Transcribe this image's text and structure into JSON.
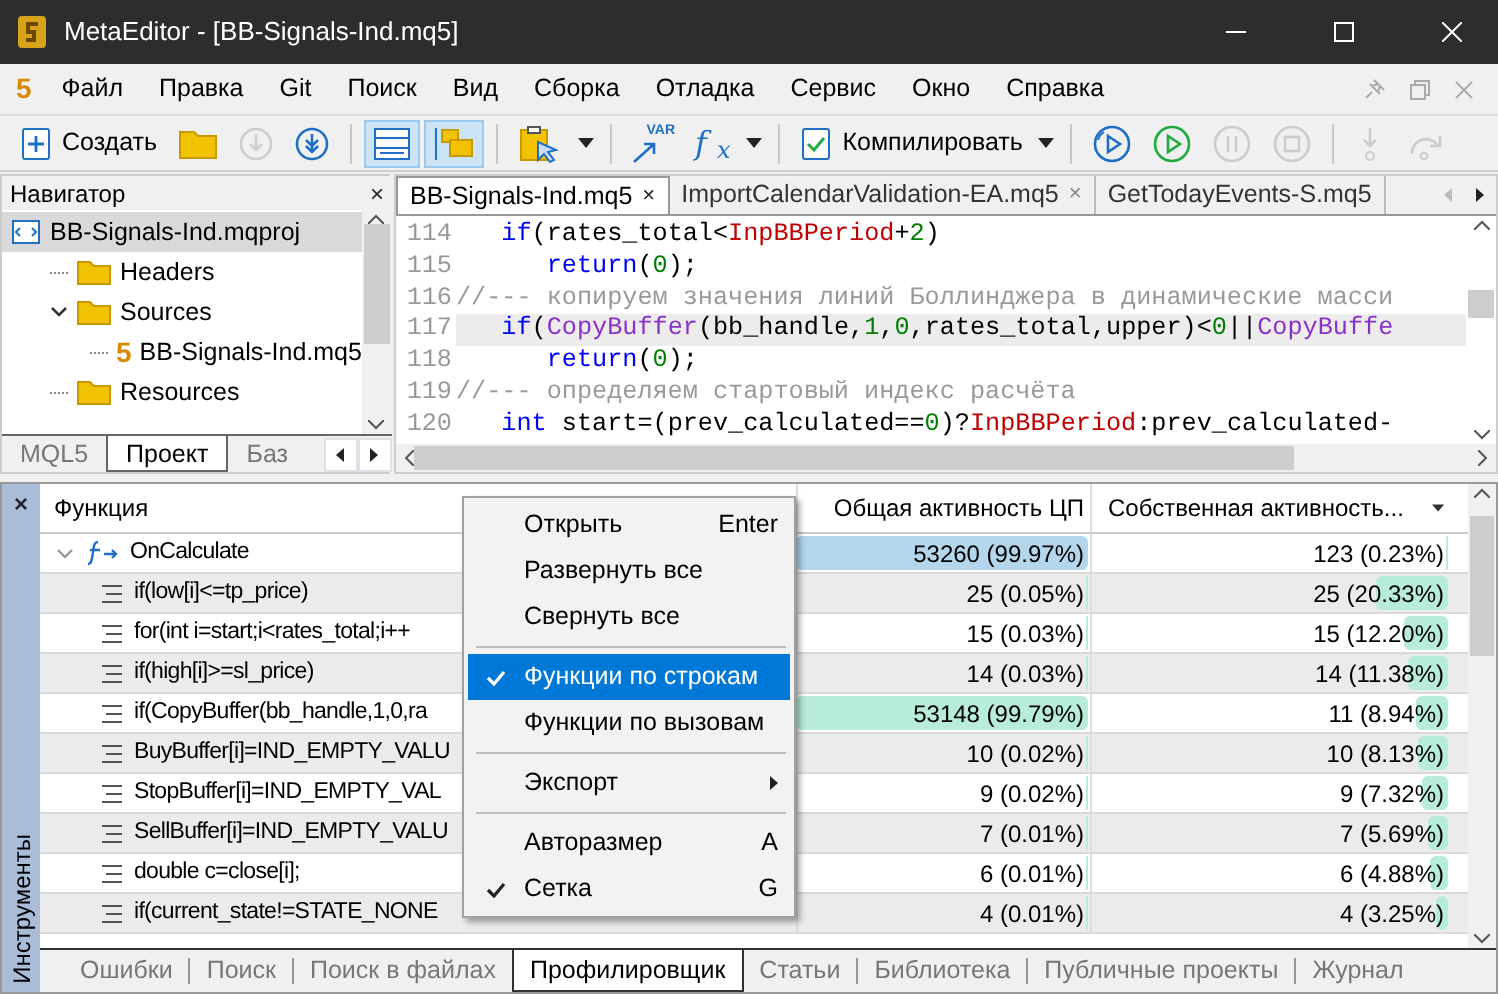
{
  "window": {
    "title": "MetaEditor - [BB-Signals-Ind.mq5]",
    "logo": "5"
  },
  "menu": [
    "Файл",
    "Правка",
    "Git",
    "Поиск",
    "Вид",
    "Сборка",
    "Отладка",
    "Сервис",
    "Окно",
    "Справка"
  ],
  "toolbar": [
    {
      "kind": "labeled",
      "label": "Создать",
      "disabled": false,
      "on": false
    },
    {
      "kind": "icon",
      "disabled": false,
      "on": false
    },
    {
      "kind": "icon",
      "disabled": true,
      "on": false
    },
    {
      "kind": "icon",
      "disabled": false,
      "on": false
    },
    {
      "kind": "separator"
    },
    {
      "kind": "icon",
      "disabled": false,
      "on": true
    },
    {
      "kind": "icon",
      "disabled": false,
      "on": true
    },
    {
      "kind": "separator"
    },
    {
      "kind": "icon",
      "disabled": false,
      "on": false
    },
    {
      "kind": "caret"
    },
    {
      "kind": "separator"
    },
    {
      "kind": "badge",
      "label": "VAR",
      "disabled": false,
      "on": false
    },
    {
      "kind": "glyph",
      "label": "f$_{x}$",
      "disabled": false,
      "on": false
    },
    {
      "kind": "caret"
    },
    {
      "kind": "separator"
    },
    {
      "kind": "labeled",
      "label": "Компилировать",
      "disabled": false,
      "on": false
    },
    {
      "kind": "caret"
    },
    {
      "kind": "separator"
    },
    {
      "kind": "icon",
      "disabled": false,
      "on": false
    },
    {
      "kind": "icon",
      "disabled": false,
      "on": false
    },
    {
      "kind": "icon",
      "disabled": true,
      "on": false
    },
    {
      "kind": "icon",
      "disabled": true,
      "on": false
    },
    {
      "kind": "separator"
    },
    {
      "kind": "icon",
      "disabled": true,
      "on": false
    },
    {
      "kind": "icon",
      "disabled": true,
      "on": false
    }
  ],
  "navigator": {
    "title": "Навигатор",
    "close": "×",
    "tree": [
      {
        "label": "BB-Signals-Ind.mqproj",
        "kind": "project",
        "selected": true,
        "expanded": true,
        "children": [
          {
            "label": "Headers",
            "kind": "folder",
            "selected": false
          },
          {
            "label": "Sources",
            "kind": "folder",
            "selected": false,
            "expanded": true,
            "children": [
              {
                "label": "BB-Signals-Ind.mq5",
                "kind": "file",
                "icon_text": "5",
                "selected": false
              }
            ]
          },
          {
            "label": "Resources",
            "kind": "folder",
            "selected": false
          }
        ]
      }
    ],
    "tabs": [
      {
        "label": "MQL5",
        "selected": false
      },
      {
        "label": "Проект",
        "selected": true
      },
      {
        "label": "Баз",
        "selected": false
      }
    ]
  },
  "editor": {
    "tabs": [
      {
        "label": "BB-Signals-Ind.mq5",
        "close": "×",
        "selected": true
      },
      {
        "label": "ImportCalendarValidation-EA.mq5",
        "close": "×",
        "selected": false
      },
      {
        "label": "GetTodayEvents-S.mq5",
        "selected": false
      }
    ],
    "lines": [
      {
        "number": "114",
        "highlighted": false,
        "tokens": [
          {
            "kind": "keyword",
            "text": "   if"
          },
          {
            "kind": "plain",
            "text": "(rates_total<"
          },
          {
            "kind": "input",
            "text": "InpBBPeriod"
          },
          {
            "kind": "plain",
            "text": "+"
          },
          {
            "kind": "number",
            "text": "2"
          },
          {
            "kind": "plain",
            "text": ")"
          }
        ]
      },
      {
        "number": "115",
        "highlighted": false,
        "tokens": [
          {
            "kind": "keyword",
            "text": "      return"
          },
          {
            "kind": "plain",
            "text": "("
          },
          {
            "kind": "number",
            "text": "0"
          },
          {
            "kind": "plain",
            "text": ");"
          }
        ]
      },
      {
        "number": "116",
        "highlighted": false,
        "tokens": [
          {
            "kind": "comment",
            "text": "//--- копируем значения линий Боллинджера в динамические масси"
          }
        ]
      },
      {
        "number": "117",
        "highlighted": true,
        "tokens": [
          {
            "kind": "keyword",
            "text": "   if"
          },
          {
            "kind": "plain",
            "text": "("
          },
          {
            "kind": "function",
            "text": "CopyBuffer"
          },
          {
            "kind": "plain",
            "text": "(bb_handle,"
          },
          {
            "kind": "number",
            "text": "1"
          },
          {
            "kind": "plain",
            "text": ","
          },
          {
            "kind": "number",
            "text": "0"
          },
          {
            "kind": "plain",
            "text": ",rates_total,upper)<"
          },
          {
            "kind": "number",
            "text": "0"
          },
          {
            "kind": "plain",
            "text": "||"
          },
          {
            "kind": "function",
            "text": "CopyBuffe"
          }
        ]
      },
      {
        "number": "118",
        "highlighted": false,
        "tokens": [
          {
            "kind": "keyword",
            "text": "      return"
          },
          {
            "kind": "plain",
            "text": "("
          },
          {
            "kind": "number",
            "text": "0"
          },
          {
            "kind": "plain",
            "text": ");"
          }
        ]
      },
      {
        "number": "119",
        "highlighted": false,
        "tokens": [
          {
            "kind": "comment",
            "text": "//--- определяем стартовый индекс расчёта"
          }
        ]
      },
      {
        "number": "120",
        "highlighted": false,
        "tokens": [
          {
            "kind": "keyword",
            "text": "   int"
          },
          {
            "kind": "plain",
            "text": " start=(prev_calculated=="
          },
          {
            "kind": "number",
            "text": "0"
          },
          {
            "kind": "plain",
            "text": ")?"
          },
          {
            "kind": "input",
            "text": "InpBBPeriod"
          },
          {
            "kind": "plain",
            "text": ":prev_calculated-"
          }
        ]
      }
    ]
  },
  "profiler": {
    "side_label": "Инструменты",
    "close": "×",
    "columns": [
      {
        "label": "Функция",
        "sort": false
      },
      {
        "label": "Общая активность ЦП",
        "sort": false
      },
      {
        "label": "Собственная активность...",
        "sort": true
      }
    ],
    "rows": [
      {
        "kind": "function",
        "function": "OnCalculate",
        "expanded": true,
        "total": {
          "text": "53260 (99.97%)",
          "level": 0.9997
        },
        "self": {
          "text": "123  (0.23%)",
          "level": 0.0023
        }
      },
      {
        "kind": "line",
        "function": "if(low[i]<=tp_price)",
        "total": {
          "text": "25  (0.05%)",
          "level": 0.0005
        },
        "self": {
          "text": "25 (20.33%)",
          "level": 0.2033
        }
      },
      {
        "kind": "line",
        "function": "for(int i=start;i<rates_total;i++",
        "total": {
          "text": "15  (0.03%)",
          "level": 0.0003
        },
        "self": {
          "text": "15 (12.20%)",
          "level": 0.122
        }
      },
      {
        "kind": "line",
        "function": "if(high[i]>=sl_price)",
        "total": {
          "text": "14  (0.03%)",
          "level": 0.0003
        },
        "self": {
          "text": "14 (11.38%)",
          "level": 0.1138
        }
      },
      {
        "kind": "line",
        "function": "if(CopyBuffer(bb_handle,1,0,ra",
        "total": {
          "text": "53148 (99.79%)",
          "level": 0.9979
        },
        "self": {
          "text": "11  (8.94%)",
          "level": 0.0894
        }
      },
      {
        "kind": "line",
        "function": "BuyBuffer[i]=IND_EMPTY_VALU",
        "total": {
          "text": "10  (0.02%)",
          "level": 0.0002
        },
        "self": {
          "text": "10  (8.13%)",
          "level": 0.0813
        }
      },
      {
        "kind": "line",
        "function": "StopBuffer[i]=IND_EMPTY_VAL",
        "total": {
          "text": "9  (0.02%)",
          "level": 0.0002
        },
        "self": {
          "text": "9  (7.32%)",
          "level": 0.0732
        }
      },
      {
        "kind": "line",
        "function": "SellBuffer[i]=IND_EMPTY_VALU",
        "total": {
          "text": "7  (0.01%)",
          "level": 0.0001
        },
        "self": {
          "text": "7  (5.69%)",
          "level": 0.0569
        }
      },
      {
        "kind": "line",
        "function": "double c=close[i];",
        "total": {
          "text": "6  (0.01%)",
          "level": 0.0001
        },
        "self": {
          "text": "6  (4.88%)",
          "level": 0.0488
        }
      },
      {
        "kind": "line",
        "function": "if(current_state!=STATE_NONE",
        "total": {
          "text": "4  (0.01%)",
          "level": 0.0001
        },
        "self": {
          "text": "4  (3.25%)",
          "level": 0.0325
        }
      }
    ],
    "tabs": [
      {
        "label": "Ошибки",
        "selected": false
      },
      {
        "label": "Поиск",
        "selected": false
      },
      {
        "label": "Поиск в файлах",
        "selected": false
      },
      {
        "label": "Профилировщик",
        "selected": true
      },
      {
        "label": "Статьи",
        "selected": false
      },
      {
        "label": "Библиотека",
        "selected": false
      },
      {
        "label": "Публичные проекты",
        "selected": false
      },
      {
        "label": "Журнал",
        "selected": false
      }
    ]
  },
  "context_menu": [
    {
      "kind": "item",
      "label": "Открыть",
      "shortcut": "Enter",
      "checked": false,
      "highlighted": false
    },
    {
      "kind": "item",
      "label": "Развернуть все",
      "checked": false,
      "highlighted": false
    },
    {
      "kind": "item",
      "label": "Свернуть все",
      "checked": false,
      "highlighted": false
    },
    {
      "kind": "separator"
    },
    {
      "kind": "item",
      "label": "Функции по строкам",
      "checked": true,
      "highlighted": true
    },
    {
      "kind": "item",
      "label": "Функции по вызовам",
      "checked": false,
      "highlighted": false
    },
    {
      "kind": "separator"
    },
    {
      "kind": "submenu",
      "label": "Экспорт",
      "checked": false,
      "highlighted": false
    },
    {
      "kind": "separator"
    },
    {
      "kind": "item",
      "label": "Авторазмер",
      "shortcut": "A",
      "checked": false,
      "highlighted": false
    },
    {
      "kind": "item",
      "label": "Сетка",
      "shortcut": "G",
      "checked": true,
      "highlighted": false
    }
  ]
}
